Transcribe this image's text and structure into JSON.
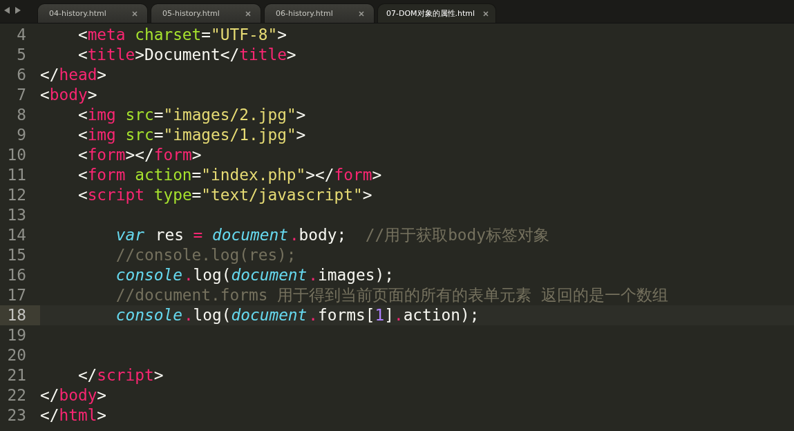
{
  "tabs": [
    {
      "label": "04-history.html",
      "selected": false
    },
    {
      "label": "05-history.html",
      "selected": false
    },
    {
      "label": "06-history.html",
      "selected": false
    },
    {
      "label": "07-DOM对象的属性.html",
      "selected": true
    }
  ],
  "editor": {
    "lines": [
      {
        "number": "4",
        "current": false,
        "tokens": [
          {
            "kind": "plain",
            "text": "    <"
          },
          {
            "kind": "tag",
            "text": "meta "
          },
          {
            "kind": "attr",
            "text": "charset"
          },
          {
            "kind": "plain",
            "text": "="
          },
          {
            "kind": "string",
            "text": "\"UTF-8\""
          },
          {
            "kind": "plain",
            "text": ">"
          }
        ]
      },
      {
        "number": "5",
        "current": false,
        "tokens": [
          {
            "kind": "plain",
            "text": "    <"
          },
          {
            "kind": "tag",
            "text": "title"
          },
          {
            "kind": "plain",
            "text": ">Document</"
          },
          {
            "kind": "tag",
            "text": "title"
          },
          {
            "kind": "plain",
            "text": ">"
          }
        ]
      },
      {
        "number": "6",
        "current": false,
        "tokens": [
          {
            "kind": "plain",
            "text": "</"
          },
          {
            "kind": "tag",
            "text": "head"
          },
          {
            "kind": "plain",
            "text": ">"
          }
        ]
      },
      {
        "number": "7",
        "current": false,
        "tokens": [
          {
            "kind": "plain",
            "text": "<"
          },
          {
            "kind": "tag",
            "text": "body"
          },
          {
            "kind": "plain",
            "text": ">"
          }
        ]
      },
      {
        "number": "8",
        "current": false,
        "tokens": [
          {
            "kind": "plain",
            "text": "    <"
          },
          {
            "kind": "tag",
            "text": "img "
          },
          {
            "kind": "attr",
            "text": "src"
          },
          {
            "kind": "plain",
            "text": "="
          },
          {
            "kind": "string",
            "text": "\"images/2.jpg\""
          },
          {
            "kind": "plain",
            "text": ">"
          }
        ]
      },
      {
        "number": "9",
        "current": false,
        "tokens": [
          {
            "kind": "plain",
            "text": "    <"
          },
          {
            "kind": "tag",
            "text": "img "
          },
          {
            "kind": "attr",
            "text": "src"
          },
          {
            "kind": "plain",
            "text": "="
          },
          {
            "kind": "string",
            "text": "\"images/1.jpg\""
          },
          {
            "kind": "plain",
            "text": ">"
          }
        ]
      },
      {
        "number": "10",
        "current": false,
        "tokens": [
          {
            "kind": "plain",
            "text": "    <"
          },
          {
            "kind": "tag",
            "text": "form"
          },
          {
            "kind": "plain",
            "text": "></"
          },
          {
            "kind": "tag",
            "text": "form"
          },
          {
            "kind": "plain",
            "text": ">"
          }
        ]
      },
      {
        "number": "11",
        "current": false,
        "tokens": [
          {
            "kind": "plain",
            "text": "    <"
          },
          {
            "kind": "tag",
            "text": "form "
          },
          {
            "kind": "attr",
            "text": "action"
          },
          {
            "kind": "plain",
            "text": "="
          },
          {
            "kind": "string",
            "text": "\"index.php\""
          },
          {
            "kind": "plain",
            "text": "></"
          },
          {
            "kind": "tag",
            "text": "form"
          },
          {
            "kind": "plain",
            "text": ">"
          }
        ]
      },
      {
        "number": "12",
        "current": false,
        "tokens": [
          {
            "kind": "plain",
            "text": "    <"
          },
          {
            "kind": "tag",
            "text": "script "
          },
          {
            "kind": "attr",
            "text": "type"
          },
          {
            "kind": "plain",
            "text": "="
          },
          {
            "kind": "string",
            "text": "\"text/javascript\""
          },
          {
            "kind": "plain",
            "text": ">"
          }
        ]
      },
      {
        "number": "13",
        "current": false
      },
      {
        "number": "14",
        "current": false,
        "tokens": [
          {
            "kind": "storage",
            "text": "        var"
          },
          {
            "kind": "plain",
            "text": " res "
          },
          {
            "kind": "operator",
            "text": "= "
          },
          {
            "kind": "storage",
            "text": "document"
          },
          {
            "kind": "member",
            "text": ".body;  "
          },
          {
            "kind": "comment",
            "text": "//用于获取body标签对象"
          }
        ]
      },
      {
        "number": "15",
        "current": false,
        "tokens": [
          {
            "kind": "comment",
            "text": "        //console.log(res);"
          }
        ]
      },
      {
        "number": "16",
        "current": false,
        "tokens": [
          {
            "kind": "storage",
            "text": "        console"
          },
          {
            "kind": "member",
            "text": ".log("
          },
          {
            "kind": "storage",
            "text": "document"
          },
          {
            "kind": "member",
            "text": ".images);"
          }
        ]
      },
      {
        "number": "17",
        "current": false,
        "tokens": [
          {
            "kind": "comment",
            "text": "        //document.forms 用于得到当前页面的所有的表单元素 返回的是一个数组"
          }
        ]
      },
      {
        "number": "18",
        "current": true,
        "tokens": [
          {
            "kind": "storage",
            "text": "        console"
          },
          {
            "kind": "member",
            "text": ".log("
          },
          {
            "kind": "storage",
            "text": "document"
          },
          {
            "kind": "member",
            "text": ".forms["
          },
          {
            "kind": "number",
            "text": "1"
          },
          {
            "kind": "plain",
            "text": "]"
          },
          {
            "kind": "member",
            "text": ".action);"
          }
        ]
      },
      {
        "number": "19",
        "current": false
      },
      {
        "number": "20",
        "current": false
      },
      {
        "number": "21",
        "current": false,
        "tokens": [
          {
            "kind": "plain",
            "text": "    </"
          },
          {
            "kind": "tag",
            "text": "script"
          },
          {
            "kind": "plain",
            "text": ">"
          }
        ]
      },
      {
        "number": "22",
        "current": false,
        "tokens": [
          {
            "kind": "plain",
            "text": "</"
          },
          {
            "kind": "tag",
            "text": "body"
          },
          {
            "kind": "plain",
            "text": ">"
          }
        ]
      },
      {
        "number": "23",
        "current": false,
        "tokens": [
          {
            "kind": "plain",
            "text": "</"
          },
          {
            "kind": "tag",
            "text": "html"
          },
          {
            "kind": "plain",
            "text": ">"
          }
        ]
      }
    ]
  }
}
